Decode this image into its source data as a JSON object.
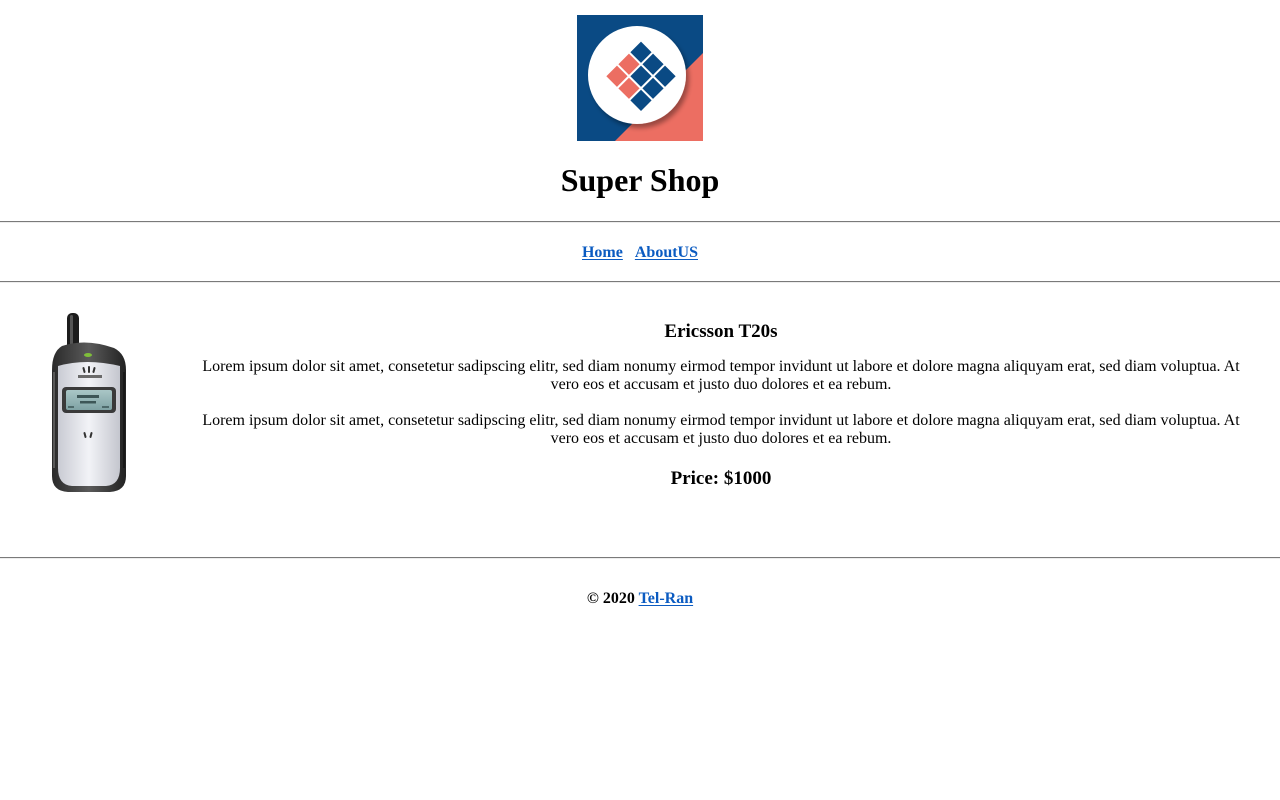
{
  "header": {
    "logo_icon": "diamond-grid-logo-icon",
    "title": "Super Shop"
  },
  "nav": {
    "items": [
      {
        "label": "Home"
      },
      {
        "label": "AboutUS"
      }
    ]
  },
  "product": {
    "image_icon": "mobile-phone-image",
    "name": "Ericsson T20s",
    "descriptions": [
      "Lorem ipsum dolor sit amet, consetetur sadipscing elitr, sed diam nonumy eirmod tempor invidunt ut labore et dolore magna aliquyam erat, sed diam voluptua. At vero eos et accusam et justo duo dolores et ea rebum.",
      "Lorem ipsum dolor sit amet, consetetur sadipscing elitr, sed diam nonumy eirmod tempor invidunt ut labore et dolore magna aliquyam erat, sed diam voluptua. At vero eos et accusam et justo duo dolores et ea rebum."
    ],
    "price": "Price: $1000"
  },
  "footer": {
    "copyright": "© 2020",
    "link_label": "Tel-Ran"
  },
  "colors": {
    "link": "#0b5bc1",
    "logo_blue": "#0a4a84",
    "logo_coral": "#ec6e62"
  }
}
